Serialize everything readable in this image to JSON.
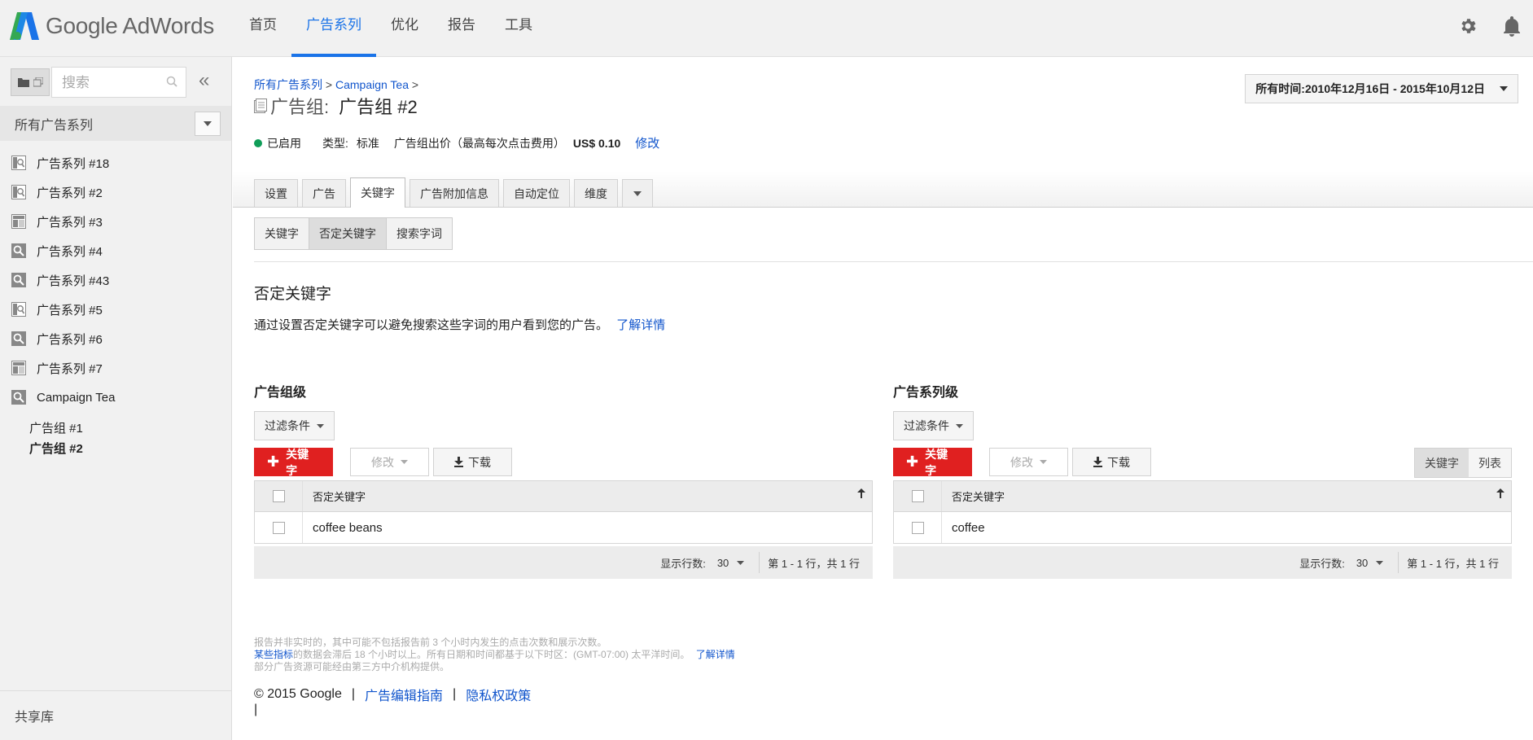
{
  "app": {
    "name": "Google AdWords"
  },
  "nav": {
    "items": [
      {
        "label": "首页",
        "active": false
      },
      {
        "label": "广告系列",
        "active": true
      },
      {
        "label": "优化",
        "active": false
      },
      {
        "label": "报告",
        "active": false
      },
      {
        "label": "工具",
        "active": false
      }
    ]
  },
  "colors": {
    "accent": "#1a73e8",
    "red_button": "#e02020",
    "enabled_dot": "#0f9d58",
    "link": "#1155cc"
  },
  "sidebar": {
    "search_placeholder": "搜索",
    "collapse_glyph": "«",
    "all_campaigns_label": "所有广告系列",
    "campaigns": [
      {
        "label": "广告系列 #18",
        "icon": "display-search-icon"
      },
      {
        "label": "广告系列 #2",
        "icon": "display-search-icon"
      },
      {
        "label": "广告系列 #3",
        "icon": "layout-icon"
      },
      {
        "label": "广告系列 #4",
        "icon": "search-icon"
      },
      {
        "label": "广告系列 #43",
        "icon": "search-icon"
      },
      {
        "label": "广告系列 #5",
        "icon": "display-search-icon"
      },
      {
        "label": "广告系列 #6",
        "icon": "search-icon"
      },
      {
        "label": "广告系列 #7",
        "icon": "layout-icon"
      },
      {
        "label": "Campaign Tea",
        "icon": "search-icon"
      }
    ],
    "ad_groups": [
      {
        "label": "广告组 #1",
        "active": false
      },
      {
        "label": "广告组 #2",
        "active": true
      }
    ],
    "shared_library_label": "共享库"
  },
  "breadcrumb": {
    "all_campaigns": "所有广告系列",
    "sep1": ">",
    "campaign": "Campaign Tea",
    "sep2": ">"
  },
  "title": {
    "lead": "广告组:",
    "name": "广告组 #2"
  },
  "status": {
    "enabled_label": "已启用",
    "type_label": "类型:",
    "type_value": "标准",
    "bid_label": "广告组出价（最高每次点击费用）",
    "bid_value": "US$ 0.10",
    "edit_link": "修改"
  },
  "date_range": {
    "label": "所有时间:",
    "value": "2010年12月16日 - 2015年10月12日"
  },
  "tabs": [
    {
      "label": "设置",
      "active": false
    },
    {
      "label": "广告",
      "active": false
    },
    {
      "label": "关键字",
      "active": true
    },
    {
      "label": "广告附加信息",
      "active": false
    },
    {
      "label": "自动定位",
      "active": false
    },
    {
      "label": "维度",
      "active": false
    }
  ],
  "subtabs": [
    {
      "label": "关键字",
      "active": false
    },
    {
      "label": "否定关键字",
      "active": true
    },
    {
      "label": "搜索字词",
      "active": false
    }
  ],
  "section": {
    "title": "否定关键字",
    "description": "通过设置否定关键字可以避免搜索这些字词的用户看到您的广告。",
    "learn_more": "了解详情"
  },
  "panels": {
    "ad_group": {
      "title": "广告组级",
      "filter_label": "过滤条件",
      "add_button": "关键字",
      "edit_button": "修改",
      "download_button": "下载",
      "column_header": "否定关键字",
      "rows": [
        "coffee beans"
      ],
      "rows_label": "显示行数:",
      "rows_value": "30",
      "page_info": "第 1 - 1 行，共 1 行"
    },
    "campaign": {
      "title": "广告系列级",
      "filter_label": "过滤条件",
      "add_button": "关键字",
      "edit_button": "修改",
      "download_button": "下载",
      "toggle_keyword": "关键字",
      "toggle_list": "列表",
      "column_header": "否定关键字",
      "rows": [
        "coffee"
      ],
      "rows_label": "显示行数:",
      "rows_value": "30",
      "page_info": "第 1 - 1 行，共 1 行"
    }
  },
  "fine_print": {
    "line1": "报告并非实时的，其中可能不包括报告前 3 个小时内发生的点击次数和展示次数。",
    "line2_link": "某些指标",
    "line2_text": "的数据会滞后 18 个小时以上。所有日期和时间都基于以下时区：(GMT-07:00) 太平洋时间。",
    "line2_learn": "了解详情",
    "line3": "部分广告资源可能经由第三方中介机构提供。"
  },
  "footer": {
    "copyright": "© 2015 Google",
    "sep": "|",
    "editorial": "广告编辑指南",
    "privacy": "隐私权政策"
  },
  "cursor_text": "|"
}
